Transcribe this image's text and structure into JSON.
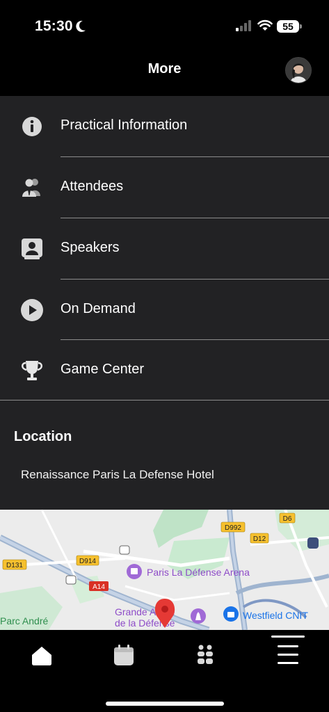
{
  "status_bar": {
    "time": "15:30",
    "battery": "55"
  },
  "header": {
    "title": "More"
  },
  "menu": {
    "items": [
      {
        "label": "Practical Information",
        "icon": "info-icon"
      },
      {
        "label": "Attendees",
        "icon": "people-icon"
      },
      {
        "label": "Speakers",
        "icon": "speaker-icon"
      },
      {
        "label": "On Demand",
        "icon": "play-icon"
      },
      {
        "label": "Game Center",
        "icon": "trophy-icon"
      }
    ]
  },
  "location": {
    "heading": "Location",
    "address": "Renaissance Paris La Defense Hotel"
  },
  "map": {
    "labels": {
      "arena": "Paris La Défense Arena",
      "grande_arche_1": "Grande Arche",
      "grande_arche_2": "de la Défense",
      "westfield": "Westfield CNIT",
      "parc": "Parc André",
      "d6": "D6",
      "d992": "D992",
      "d12": "D12",
      "d131": "D131",
      "d914": "D914",
      "a14": "A14"
    },
    "colors": {
      "poi": "#a06ad6",
      "pin": "#e53935",
      "westfield": "#1a73e8",
      "park": "#2f8f4e"
    }
  },
  "tabbar": {
    "tabs": [
      {
        "icon": "home-icon"
      },
      {
        "icon": "calendar-icon"
      },
      {
        "icon": "people-grid-icon"
      },
      {
        "icon": "menu-icon"
      }
    ]
  }
}
